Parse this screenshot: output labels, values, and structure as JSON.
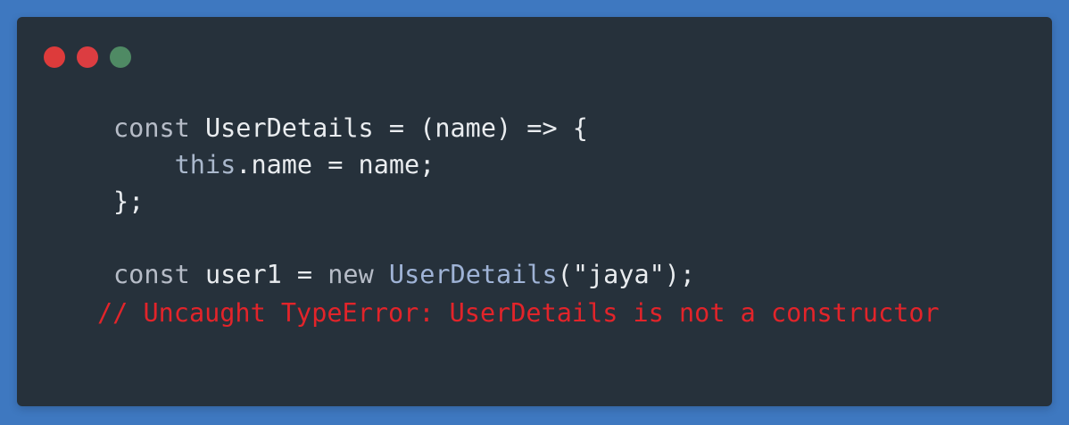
{
  "window": {
    "controls": {
      "close_color": "#dd3b3b",
      "minimize_color": "#dc3d41",
      "maximize_color": "#4f8a64"
    }
  },
  "code": {
    "line1": {
      "kw": "const",
      "name": "UserDetails",
      "rest": " = (name) => {"
    },
    "line2": {
      "indent": "    ",
      "this_kw": "this",
      "rest": ".name = name;"
    },
    "line3": {
      "text": "};"
    },
    "line5": {
      "kw": "const",
      "var": "user1",
      "eq": " = ",
      "new_kw": "new",
      "cls": "UserDetails",
      "args": "(\"jaya\");"
    },
    "comment": "// Uncaught TypeError: UserDetails is not a constructor"
  }
}
